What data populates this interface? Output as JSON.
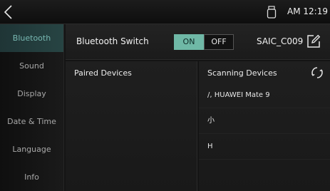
{
  "status_bar": {
    "clock": "AM 12:19",
    "icons": [
      "back-chevron-icon",
      "usb-icon"
    ]
  },
  "sidebar": {
    "items": [
      {
        "label": "Bluetooth",
        "active": true
      },
      {
        "label": "Sound",
        "active": false
      },
      {
        "label": "Display",
        "active": false
      },
      {
        "label": "Date & Time",
        "active": false
      },
      {
        "label": "Language",
        "active": false
      },
      {
        "label": "Info",
        "active": false
      }
    ]
  },
  "bluetooth": {
    "switch_label": "Bluetooth Switch",
    "on_label": "ON",
    "off_label": "OFF",
    "state": "ON",
    "device_name": "SAIC_C009",
    "edit_icon": "edit-pencil-icon"
  },
  "paired": {
    "title": "Paired Devices",
    "devices": []
  },
  "scanning": {
    "title": "Scanning Devices",
    "refresh_icon": "refresh-icon",
    "devices": [
      "/, HUAWEI Mate 9",
      "小",
      "H"
    ]
  },
  "colors": {
    "accent": "#6fb8a6",
    "active_text": "#78b8b2",
    "background": "#141414"
  }
}
